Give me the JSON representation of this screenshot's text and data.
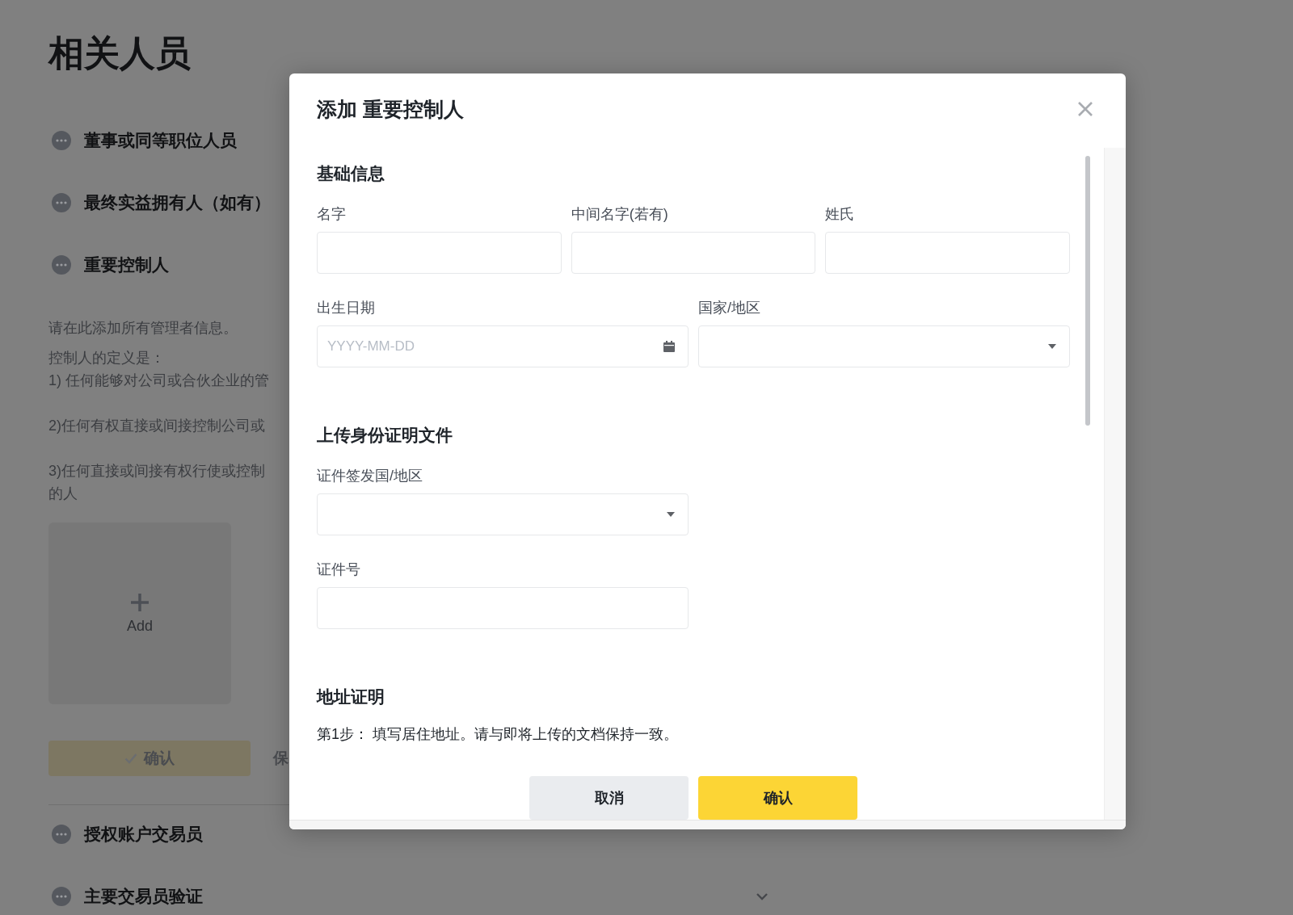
{
  "page": {
    "title": "相关人员",
    "sections": [
      {
        "title": "董事或同等职位人员"
      },
      {
        "title": "最终实益拥有人（如有）"
      },
      {
        "title": "重要控制人"
      }
    ],
    "description": [
      [
        "请在此添加所有管理者信息。"
      ],
      [
        "控制人的定义是：",
        "1) 任何能够对公司或合伙企业的管"
      ],
      [
        "2)任何有权直接或间接控制公司或"
      ],
      [
        "3)任何直接或间接有权行使或控制",
        "的人"
      ]
    ],
    "add_card": {
      "label": "Add"
    },
    "confirm_button": "确认",
    "save_link": "保",
    "more_sections": [
      {
        "title": "授权账户交易员",
        "collapsible": false
      },
      {
        "title": "主要交易员验证",
        "collapsible": true
      }
    ]
  },
  "modal": {
    "title": "添加 重要控制人",
    "sections": [
      {
        "heading": "基础信息",
        "rows": [
          [
            {
              "label": "名字",
              "kind": "text"
            },
            {
              "label": "中间名字(若有)",
              "kind": "text"
            },
            {
              "label": "姓氏",
              "kind": "text"
            }
          ],
          [
            {
              "label": "出生日期",
              "kind": "date",
              "placeholder": "YYYY-MM-DD"
            },
            {
              "label": "国家/地区",
              "kind": "select"
            }
          ]
        ]
      },
      {
        "heading": "上传身份证明文件",
        "rows": [
          [
            {
              "label": "证件签发国/地区",
              "kind": "select"
            }
          ],
          [
            {
              "label": "证件号",
              "kind": "text"
            }
          ]
        ]
      },
      {
        "heading": "地址证明",
        "text": "第1步： 填写居住地址。请与即将上传的文档保持一致。"
      }
    ],
    "cancel_button": "取消",
    "ok_button": "确认"
  }
}
